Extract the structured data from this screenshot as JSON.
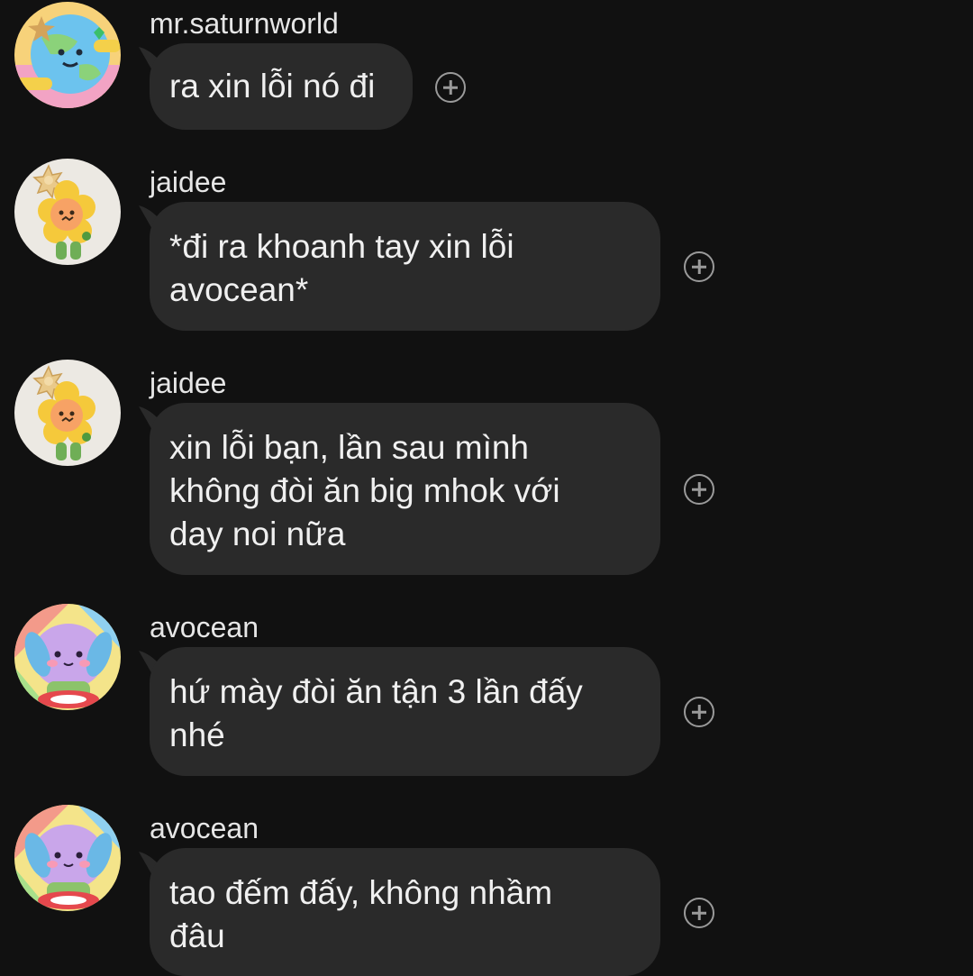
{
  "messages": [
    {
      "sender": "mr.saturnworld",
      "avatar": "earth-character-avatar-icon",
      "lines": [
        "ra xin lỗi nó đi"
      ]
    },
    {
      "sender": "jaidee",
      "avatar": "flower-cookie-avatar-icon",
      "lines": [
        "*đi ra khoanh tay xin lỗi",
        "avocean*"
      ]
    },
    {
      "sender": "jaidee",
      "avatar": "flower-cookie-avatar-icon",
      "lines": [
        "xin lỗi bạn, lần sau mình",
        "không đòi ăn big mhok với",
        "day noi nữa"
      ]
    },
    {
      "sender": "avocean",
      "avatar": "purple-bunny-avatar-icon",
      "lines": [
        "hứ mày đòi ăn tận 3 lần đấy",
        "nhé"
      ]
    },
    {
      "sender": "avocean",
      "avatar": "purple-bunny-avatar-icon",
      "lines": [
        "tao đếm đấy, không nhầm",
        "đâu"
      ]
    }
  ],
  "colors": {
    "background": "#111111",
    "bubble": "#2a2a2a",
    "text": "#f0f0f0",
    "add_reaction_icon": "#9a9a9a"
  },
  "icons": {
    "add_reaction": "plus-circle-icon"
  }
}
